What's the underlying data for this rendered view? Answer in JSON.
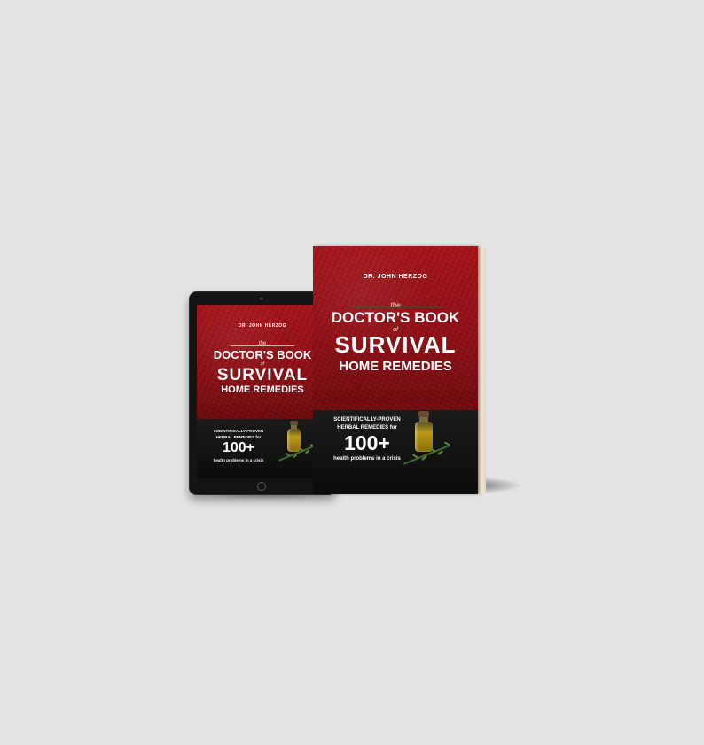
{
  "cover": {
    "author": "DR. JOHN HERZOG",
    "title_the": "the",
    "title_line1": "DOCTOR'S BOOK",
    "title_of": "of",
    "title_line2": "SURVIVAL",
    "title_line3": "HOME REMEDIES",
    "tagline_line1": "SCIENTIFICALLY-PROVEN",
    "tagline_line2": "HERBAL REMEDIES for",
    "count": "100+",
    "tagline_line3": "health problems in a crisis"
  },
  "colors": {
    "background": "#e3e3e3",
    "cover_red": "#a8151b",
    "cover_dark": "#141414"
  }
}
